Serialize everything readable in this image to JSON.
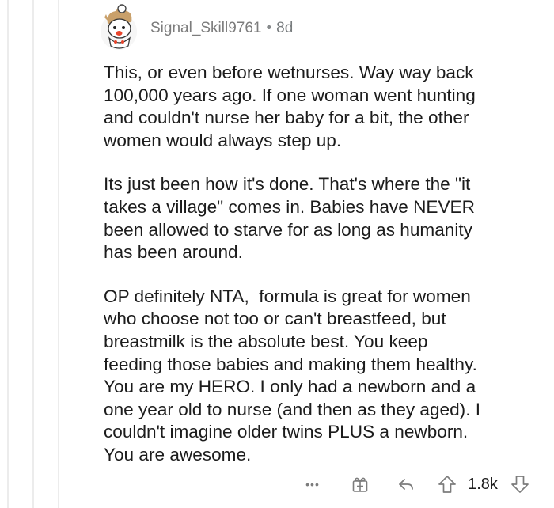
{
  "comment": {
    "author": "Signal_Skill9761",
    "separator": "•",
    "age": "8d",
    "paragraphs": [
      {
        "lines": [
          "This, or even before wetnurses. Way way back",
          "100,000 years ago. If one woman went hunting",
          "and couldn't nurse her baby for a bit, the other",
          "women would always step up."
        ]
      },
      {
        "lines": [
          "Its just been how it's done. That's where the \"it",
          "takes a village\" comes in. Babies have NEVER",
          "been allowed to starve for as long as humanity",
          "has been around."
        ]
      },
      {
        "lines": [
          "OP definitely NTA,  formula is great for women",
          "who choose not too or can't breastfeed, but",
          "breastmilk is the absolute best. You keep",
          "feeding those babies and making them healthy.",
          "You are my HERO. I only had a newborn and a",
          "one year old to nurse (and then as they aged). I",
          "couldn't imagine older twins PLUS a newborn.",
          "You are awesome."
        ]
      }
    ],
    "actions": {
      "more_label": "•••",
      "score": "1.8k"
    }
  },
  "colors": {
    "text": "#1c1c1c",
    "meta": "#7c7c7c",
    "thread_line": "#ececec",
    "avatar_accent": "#e8452c"
  },
  "icons": [
    "avatar",
    "more-icon",
    "award-icon",
    "reply-icon",
    "upvote-icon",
    "downvote-icon"
  ]
}
